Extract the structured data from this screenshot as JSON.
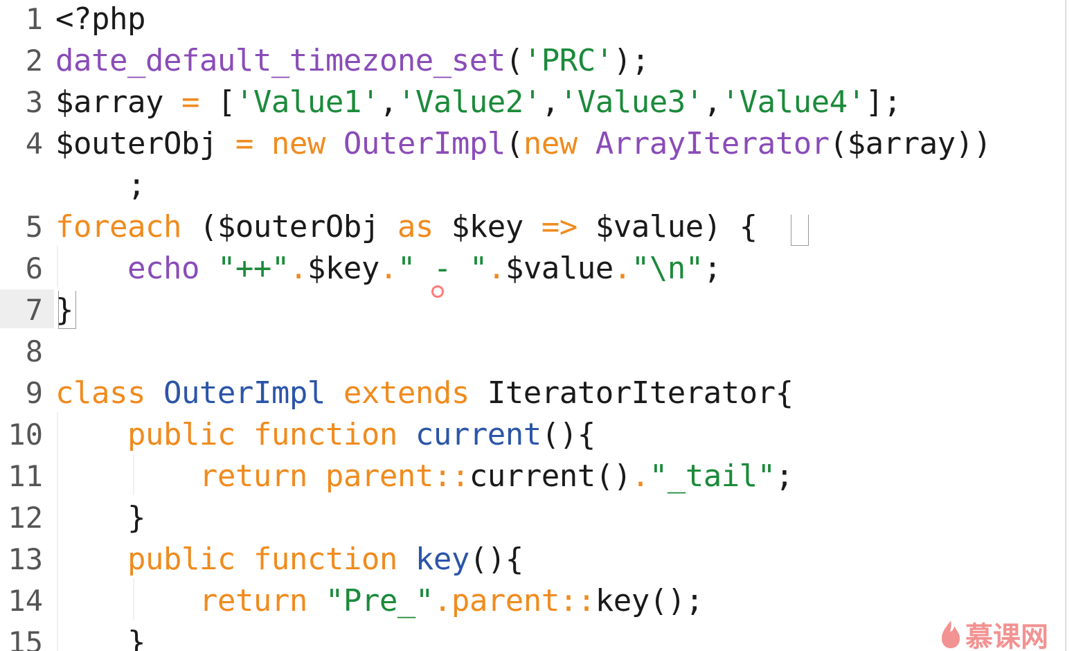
{
  "editor": {
    "active_line": 7,
    "line_numbers": [
      "1",
      "2",
      "3",
      "4",
      "5",
      "6",
      "7",
      "8",
      "9",
      "10",
      "11",
      "12",
      "13",
      "14",
      "15"
    ],
    "lines": [
      [
        {
          "t": "<?php",
          "c": "plain"
        }
      ],
      [
        {
          "t": "date_default_timezone_set",
          "c": "fn"
        },
        {
          "t": "(",
          "c": "plain"
        },
        {
          "t": "'PRC'",
          "c": "str"
        },
        {
          "t": ");",
          "c": "plain"
        }
      ],
      [
        {
          "t": "$array ",
          "c": "plain"
        },
        {
          "t": "=",
          "c": "op"
        },
        {
          "t": " [",
          "c": "plain"
        },
        {
          "t": "'Value1'",
          "c": "str"
        },
        {
          "t": ",",
          "c": "plain"
        },
        {
          "t": "'Value2'",
          "c": "str"
        },
        {
          "t": ",",
          "c": "plain"
        },
        {
          "t": "'Value3'",
          "c": "str"
        },
        {
          "t": ",",
          "c": "plain"
        },
        {
          "t": "'Value4'",
          "c": "str"
        },
        {
          "t": "];",
          "c": "plain"
        }
      ],
      [
        {
          "t": "$outerObj ",
          "c": "plain"
        },
        {
          "t": "=",
          "c": "op"
        },
        {
          "t": " ",
          "c": "plain"
        },
        {
          "t": "new",
          "c": "kw"
        },
        {
          "t": " ",
          "c": "plain"
        },
        {
          "t": "OuterImpl",
          "c": "fn"
        },
        {
          "t": "(",
          "c": "plain"
        },
        {
          "t": "new",
          "c": "kw"
        },
        {
          "t": " ",
          "c": "plain"
        },
        {
          "t": "ArrayIterator",
          "c": "fn"
        },
        {
          "t": "($array))",
          "c": "plain"
        }
      ],
      [
        {
          "t": "    ;",
          "c": "plain"
        }
      ],
      [
        {
          "t": "foreach",
          "c": "kw"
        },
        {
          "t": " ($outerObj ",
          "c": "plain"
        },
        {
          "t": "as",
          "c": "kw"
        },
        {
          "t": " $key ",
          "c": "plain"
        },
        {
          "t": "=>",
          "c": "op"
        },
        {
          "t": " $value) {",
          "c": "plain"
        }
      ],
      [
        {
          "t": "    ",
          "c": "plain"
        },
        {
          "t": "echo",
          "c": "fn"
        },
        {
          "t": " ",
          "c": "plain"
        },
        {
          "t": "\"++\"",
          "c": "str"
        },
        {
          "t": ".",
          "c": "op"
        },
        {
          "t": "$key",
          "c": "plain"
        },
        {
          "t": ".",
          "c": "op"
        },
        {
          "t": "\" - \"",
          "c": "str"
        },
        {
          "t": ".",
          "c": "op"
        },
        {
          "t": "$value",
          "c": "plain"
        },
        {
          "t": ".",
          "c": "op"
        },
        {
          "t": "\"\\n\"",
          "c": "str"
        },
        {
          "t": ";",
          "c": "plain"
        }
      ],
      [
        {
          "t": "}",
          "c": "plain"
        }
      ],
      [
        {
          "t": "",
          "c": "plain"
        }
      ],
      [
        {
          "t": "class",
          "c": "kw"
        },
        {
          "t": " ",
          "c": "plain"
        },
        {
          "t": "OuterImpl",
          "c": "cls"
        },
        {
          "t": " ",
          "c": "plain"
        },
        {
          "t": "extends",
          "c": "kw"
        },
        {
          "t": " IteratorIterator{",
          "c": "plain"
        }
      ],
      [
        {
          "t": "    ",
          "c": "plain"
        },
        {
          "t": "public",
          "c": "kw"
        },
        {
          "t": " ",
          "c": "plain"
        },
        {
          "t": "function",
          "c": "kw"
        },
        {
          "t": " ",
          "c": "plain"
        },
        {
          "t": "current",
          "c": "cls"
        },
        {
          "t": "(){",
          "c": "plain"
        }
      ],
      [
        {
          "t": "        ",
          "c": "plain"
        },
        {
          "t": "return",
          "c": "kw"
        },
        {
          "t": " ",
          "c": "plain"
        },
        {
          "t": "parent::",
          "c": "kw"
        },
        {
          "t": "current()",
          "c": "plain"
        },
        {
          "t": ".",
          "c": "op"
        },
        {
          "t": "\"_tail\"",
          "c": "str"
        },
        {
          "t": ";",
          "c": "plain"
        }
      ],
      [
        {
          "t": "    }",
          "c": "plain"
        }
      ],
      [
        {
          "t": "    ",
          "c": "plain"
        },
        {
          "t": "public",
          "c": "kw"
        },
        {
          "t": " ",
          "c": "plain"
        },
        {
          "t": "function",
          "c": "kw"
        },
        {
          "t": " ",
          "c": "plain"
        },
        {
          "t": "key",
          "c": "cls"
        },
        {
          "t": "(){",
          "c": "plain"
        }
      ],
      [
        {
          "t": "        ",
          "c": "plain"
        },
        {
          "t": "return",
          "c": "kw"
        },
        {
          "t": " ",
          "c": "plain"
        },
        {
          "t": "\"Pre_\"",
          "c": "str"
        },
        {
          "t": ".",
          "c": "op"
        },
        {
          "t": "parent::",
          "c": "kw"
        },
        {
          "t": "key();",
          "c": "plain"
        }
      ],
      [
        {
          "t": "    }",
          "c": "plain"
        }
      ]
    ]
  },
  "colors": {
    "fn": "#8a4cb8",
    "kw": "#f08b1e",
    "str": "#1b8a3a",
    "cls": "#2b55a8",
    "op": "#f08b1e",
    "plain": "#1a1a1a"
  },
  "icons": {
    "watermark": "flame-icon",
    "cursor": "click-indicator-icon"
  },
  "watermark": {
    "text": "慕课网"
  }
}
